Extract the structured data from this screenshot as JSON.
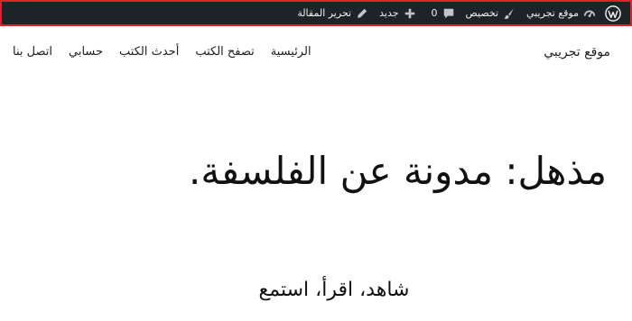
{
  "admin_bar": {
    "site_name": "موقع تجريبي",
    "customize": "تخصيص",
    "comments_count": "0",
    "new": "جديد",
    "edit_post": "تحرير المقالة"
  },
  "header": {
    "site_title": "موقع تجريبي",
    "nav": [
      "الرئيسية",
      "تصفح الكتب",
      "أحدث الكتب",
      "حسابي",
      "اتصل بنا"
    ]
  },
  "main": {
    "headline": "مذهل: مدونة عن الفلسفة.",
    "tagline": "شاهد، اقرأ، استمع"
  },
  "colors": {
    "admin_bar_bg": "#1d2327",
    "admin_bar_text": "#f0f0f1",
    "highlight_border": "#e0202a"
  }
}
